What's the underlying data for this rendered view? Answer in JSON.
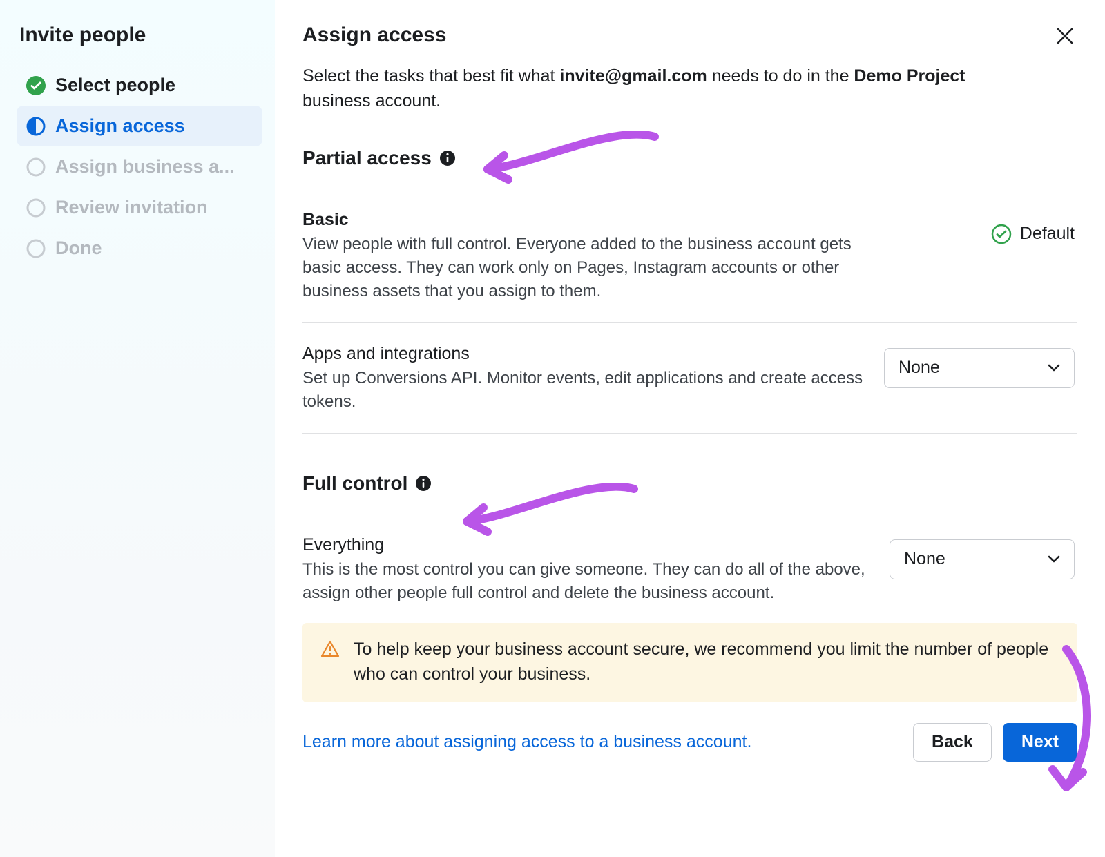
{
  "sidebar": {
    "title": "Invite people",
    "steps": [
      {
        "label": "Select people",
        "state": "completed"
      },
      {
        "label": "Assign access",
        "state": "current"
      },
      {
        "label": "Assign business a...",
        "state": "pending"
      },
      {
        "label": "Review invitation",
        "state": "pending"
      },
      {
        "label": "Done",
        "state": "pending"
      }
    ]
  },
  "main": {
    "title": "Assign access",
    "intro_prefix": "Select the tasks that best fit what ",
    "intro_email": "invite@gmail.com",
    "intro_mid": " needs to do in the ",
    "intro_account": "Demo Project",
    "intro_suffix": " business account.",
    "partial_heading": "Partial access",
    "basic": {
      "title": "Basic",
      "desc": "View people with full control. Everyone added to the business account gets basic access. They can work only on Pages, Instagram accounts or other business assets that you assign to them.",
      "badge": "Default"
    },
    "apps": {
      "title": "Apps and integrations",
      "desc": "Set up Conversions API. Monitor events, edit applications and create access tokens.",
      "value": "None"
    },
    "full_heading": "Full control",
    "everything": {
      "title": "Everything",
      "desc": "This is the most control you can give someone. They can do all of the above, assign other people full control and delete the business account.",
      "value": "None"
    },
    "banner": "To help keep your business account secure, we recommend you limit the number of people who can control your business.",
    "learn_link": "Learn more about assigning access to a business account.",
    "back": "Back",
    "next": "Next"
  },
  "colors": {
    "accent": "#0866d9",
    "annotation": "#b955e8",
    "success": "#31a24c",
    "warning": "#e9872b",
    "banner_bg": "#fdf6e2"
  }
}
